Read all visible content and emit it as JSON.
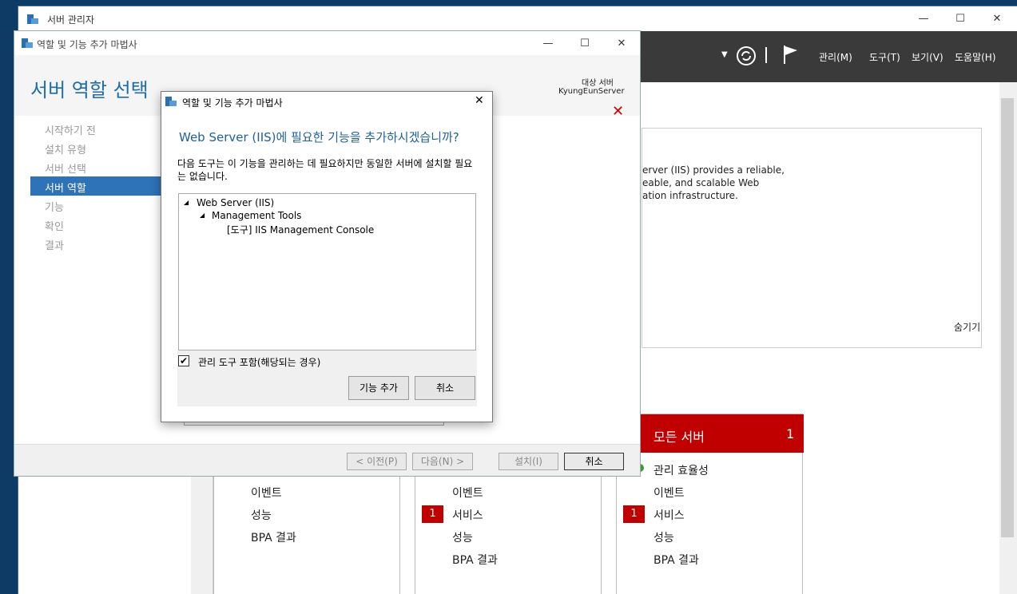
{
  "server_manager": {
    "title": "서버 관리자",
    "menus": [
      "관리(M)",
      "도구(T)",
      "보기(V)",
      "도움말(H)"
    ],
    "role_description": [
      "erver (IIS) provides a reliable,",
      "eable, and scalable Web",
      "ation infrastructure."
    ],
    "hide_label": "숨기기",
    "tiles": [
      {
        "items": [
          "이벤트",
          "성능",
          "BPA 결과"
        ]
      },
      {
        "items": [
          "이벤트",
          "서비스",
          "성능",
          "BPA 결과"
        ],
        "service_badge": "1"
      },
      {
        "header": "모든 서버",
        "count": "1",
        "items": [
          "관리 효율성",
          "이벤트",
          "서비스",
          "성능",
          "BPA 결과"
        ],
        "service_badge": "1"
      }
    ]
  },
  "wizard": {
    "title": "역할 및 기능 추가 마법사",
    "heading": "서버 역할 선택",
    "target_label": "대상 서버",
    "target_server": "KyungEunServer",
    "nav": [
      "시작하기 전",
      "설치 유형",
      "서버 선택",
      "서버 역할",
      "기능",
      "확인",
      "결과"
    ],
    "active_nav": "서버 역할",
    "buttons": {
      "prev": "< 이전(P)",
      "next": "다음(N) >",
      "install": "설치(I)",
      "cancel": "취소"
    }
  },
  "dialog": {
    "title": "역할 및 기능 추가 마법사",
    "question": "Web Server (IIS)에 필요한 기능을 추가하시겠습니까?",
    "description": "다음 도구는 이 기능을 관리하는 데 필요하지만 동일한 서버에 설치할 필요는 없습니다.",
    "tree": [
      "Web Server (IIS)",
      "Management Tools",
      "[도구] IIS Management Console"
    ],
    "checkbox_label": "관리 도구 포함(해당되는 경우)",
    "checkbox_checked": true,
    "add_button": "기능 추가",
    "cancel_button": "취소"
  },
  "colors": {
    "accent": "#2e73b8",
    "alert": "#c00000",
    "title_blue": "#1e6da8"
  }
}
